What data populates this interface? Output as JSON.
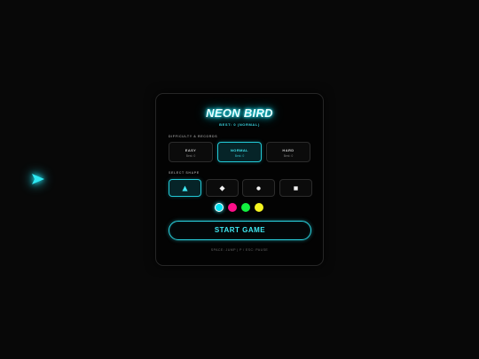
{
  "title": "NEON BIRD",
  "best_score": "BEST: 0 (NORMAL)",
  "difficulty": {
    "label": "DIFFICULTY & RECORDS",
    "options": [
      {
        "name": "EASY",
        "best": "Best: 0"
      },
      {
        "name": "NORMAL",
        "best": "Best: 0"
      },
      {
        "name": "HARD",
        "best": "Best: 0"
      }
    ],
    "selected": "NORMAL"
  },
  "shape": {
    "label": "SELECT SHAPE",
    "options": [
      {
        "name": "triangle",
        "glyph": "▲"
      },
      {
        "name": "diamond",
        "glyph": "◆"
      },
      {
        "name": "circle",
        "glyph": "●"
      },
      {
        "name": "square",
        "glyph": "■"
      }
    ],
    "selected": "triangle"
  },
  "colors": {
    "options": [
      "#00e5f5",
      "#ff0f8a",
      "#12f040",
      "#f5f520"
    ],
    "selected": "#00e5f5"
  },
  "start_button": "START GAME",
  "controls_hint": "SPACE: JUMP | P / ESC: PAUSE",
  "accent": "#22c9d6"
}
